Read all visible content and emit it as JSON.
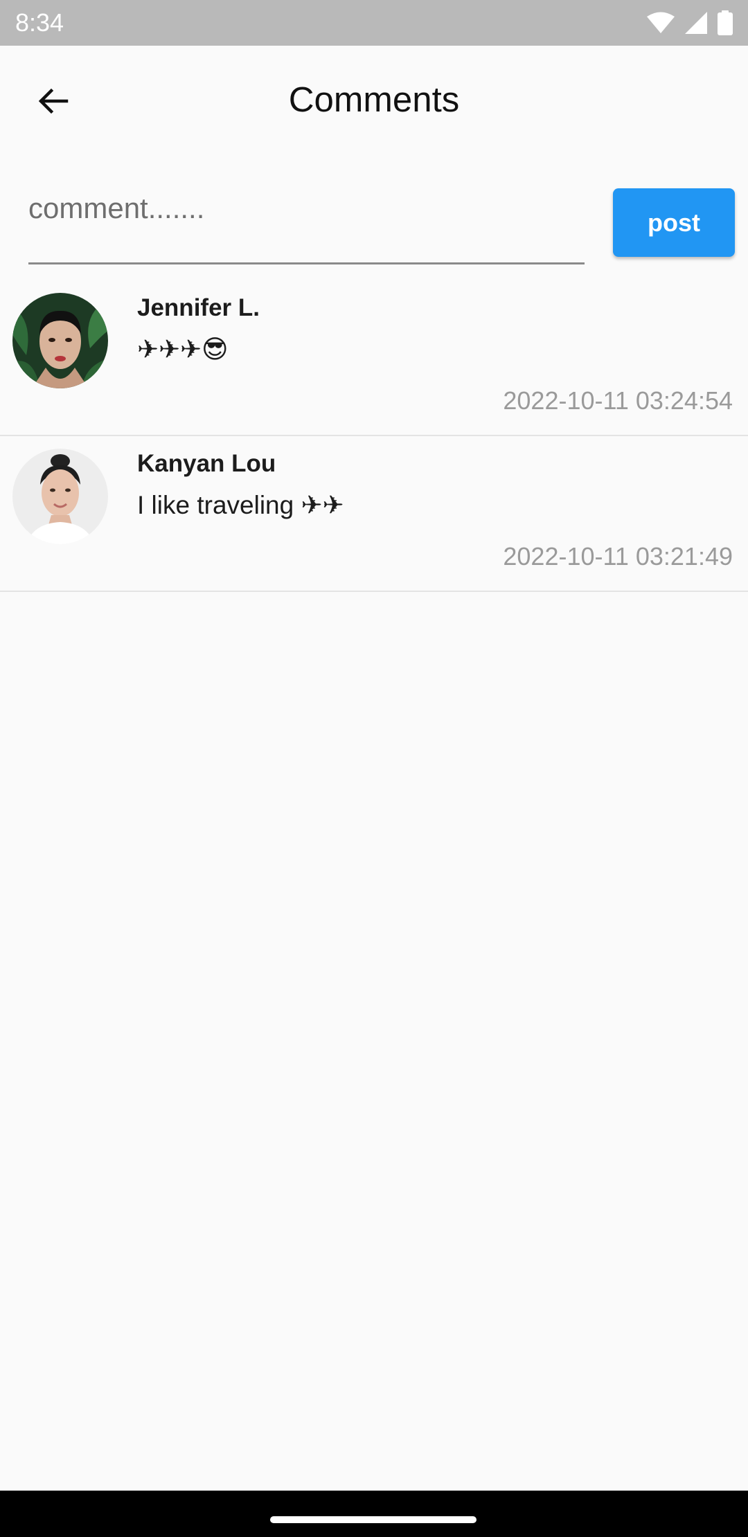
{
  "status_bar": {
    "time": "8:34",
    "icons": [
      "wifi-icon",
      "signal-icon",
      "battery-icon"
    ]
  },
  "header": {
    "title": "Comments",
    "back_icon": "arrow-left-icon"
  },
  "comment_form": {
    "placeholder": "comment.......",
    "post_label": "post",
    "accent_color": "#2196f3"
  },
  "comments": [
    {
      "author": "Jennifer L.",
      "text": "✈✈✈😎",
      "timestamp": "2022-10-11 03:24:54"
    },
    {
      "author": "Kanyan Lou",
      "text": "I like traveling ✈✈",
      "timestamp": "2022-10-11 03:21:49"
    }
  ]
}
